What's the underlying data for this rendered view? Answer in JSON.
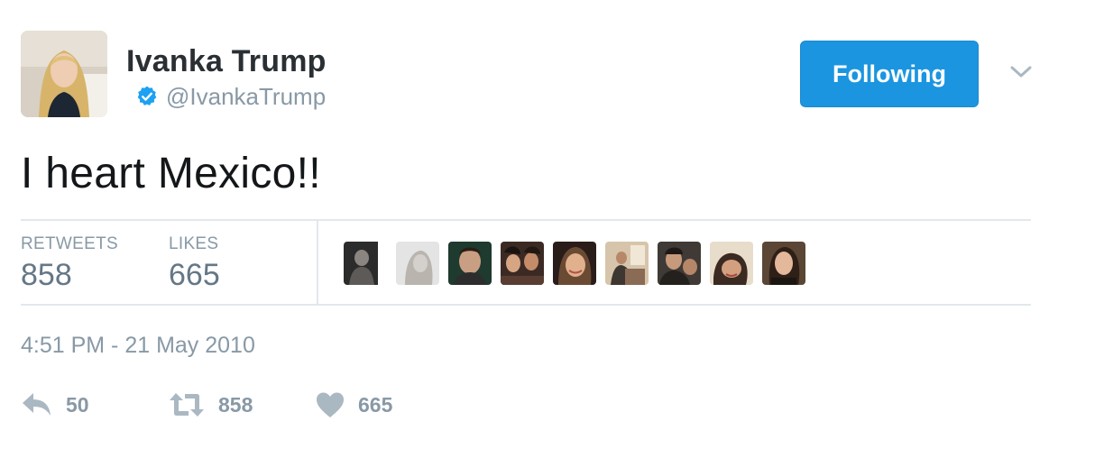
{
  "author": {
    "name": "Ivanka Trump",
    "handle": "@IvankaTrump",
    "verified": true
  },
  "follow_button": {
    "label": "Following",
    "color": "#1b95e0"
  },
  "tweet": {
    "text": "I heart Mexico!!"
  },
  "stats": {
    "retweets_label": "RETWEETS",
    "retweets_value": "858",
    "likes_label": "LIKES",
    "likes_value": "665"
  },
  "likers": [
    {
      "name": "liker-1"
    },
    {
      "name": "liker-2"
    },
    {
      "name": "liker-3"
    },
    {
      "name": "liker-4"
    },
    {
      "name": "liker-5"
    },
    {
      "name": "liker-6"
    },
    {
      "name": "liker-7"
    },
    {
      "name": "liker-8"
    },
    {
      "name": "liker-9"
    }
  ],
  "timestamp": "4:51 PM - 21 May 2010",
  "actions": {
    "reply_count": "50",
    "retweet_count": "858",
    "like_count": "665"
  },
  "colors": {
    "accent": "#1b95e0",
    "muted": "#8899a6",
    "icon": "#aab8c2"
  },
  "icons": [
    "verified-badge-icon",
    "chevron-down-icon",
    "reply-icon",
    "retweet-icon",
    "heart-icon"
  ]
}
